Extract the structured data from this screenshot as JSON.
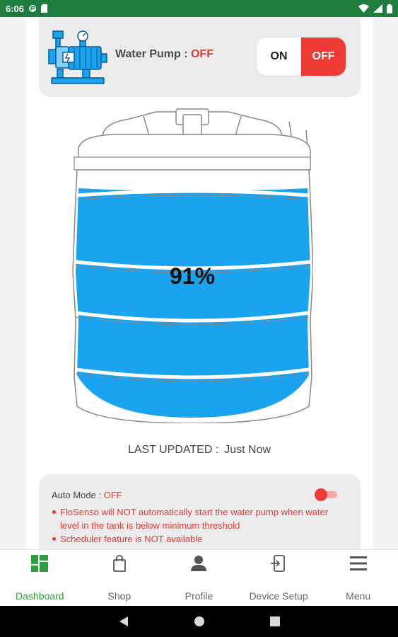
{
  "status_bar": {
    "time": "6:06"
  },
  "pump": {
    "label": "Water Pump : ",
    "state": "OFF",
    "on_label": "ON",
    "off_label": "OFF"
  },
  "tank": {
    "level_text": "91%",
    "level": 0.91
  },
  "last_updated": {
    "label": "LAST UPDATED :",
    "value": "Just Now"
  },
  "auto_mode": {
    "label": "Auto Mode : ",
    "state": "OFF",
    "notes": [
      "FloSenso will NOT automatically start the water pump when water level in the tank is below minimum threshold",
      "Scheduler feature is NOT available"
    ]
  },
  "nav": {
    "items": [
      {
        "label": "Dashboard",
        "icon": "dashboard-icon"
      },
      {
        "label": "Shop",
        "icon": "shopping-bag-icon"
      },
      {
        "label": "Profile",
        "icon": "person-icon"
      },
      {
        "label": "Device Setup",
        "icon": "device-setup-icon"
      },
      {
        "label": "Menu",
        "icon": "hamburger-menu-icon"
      }
    ]
  },
  "colors": {
    "status_bar": "#1e7d3c",
    "accent_green": "#2e9d3f",
    "off_red": "#ef3b36",
    "water_blue": "#1aa3ee"
  }
}
